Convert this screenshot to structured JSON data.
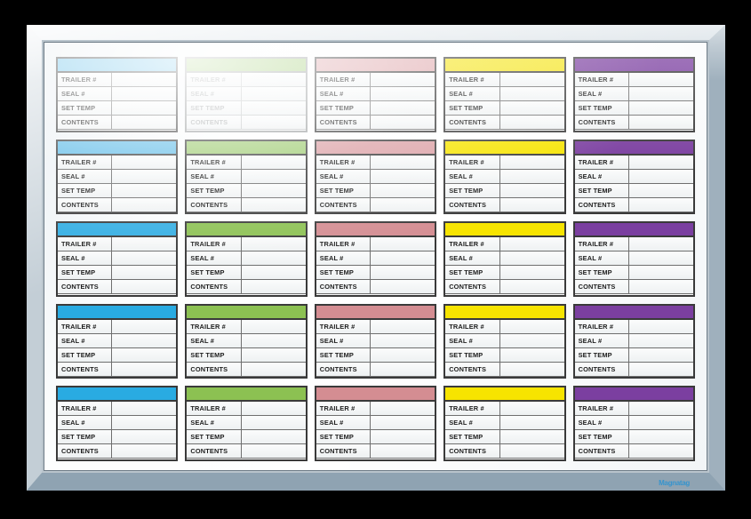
{
  "board": {
    "type": "dry-erase-whiteboard",
    "brand_mark": "Magnatag",
    "frame_color": "#b9c4cc",
    "surface_color": "#ffffff"
  },
  "card_fields": [
    "TRAILER #",
    "SEAL #",
    "SET TEMP",
    "CONTENTS"
  ],
  "columns": [
    {
      "name": "blue",
      "color": "#29abe2"
    },
    {
      "name": "green",
      "color": "#8cc152"
    },
    {
      "name": "pink",
      "color": "#d48d92"
    },
    {
      "name": "yellow",
      "color": "#f7e400"
    },
    {
      "name": "purple",
      "color": "#7b3fa0"
    }
  ],
  "grid": {
    "rows": 5,
    "cols": 5,
    "total_cards": 25
  },
  "cards": [
    [
      {
        "column": "blue",
        "header_color": "#6fc3ea",
        "faded": false,
        "trailer_no": "",
        "seal_no": "",
        "set_temp": "",
        "contents": "",
        "notes": ""
      },
      {
        "column": "green",
        "header_color": "#a5cf7c",
        "faded": true,
        "trailer_no": "",
        "seal_no": "",
        "set_temp": "",
        "contents": "",
        "notes": ""
      },
      {
        "column": "pink",
        "header_color": "#dfa9ad",
        "faded": false,
        "trailer_no": "",
        "seal_no": "",
        "set_temp": "",
        "contents": "",
        "notes": ""
      },
      {
        "column": "yellow",
        "header_color": "#f5e41b",
        "faded": false,
        "trailer_no": "",
        "seal_no": "",
        "set_temp": "",
        "contents": "",
        "notes": ""
      },
      {
        "column": "purple",
        "header_color": "#7b3fa0",
        "faded": false,
        "trailer_no": "",
        "seal_no": "",
        "set_temp": "",
        "contents": "",
        "notes": ""
      }
    ],
    [
      {
        "column": "blue",
        "header_color": "#63bde8",
        "faded": false,
        "trailer_no": "",
        "seal_no": "",
        "set_temp": "",
        "contents": "",
        "notes": ""
      },
      {
        "column": "green",
        "header_color": "#9ecb72",
        "faded": false,
        "trailer_no": "",
        "seal_no": "",
        "set_temp": "",
        "contents": "",
        "notes": ""
      },
      {
        "column": "pink",
        "header_color": "#dba0a5",
        "faded": false,
        "trailer_no": "",
        "seal_no": "",
        "set_temp": "",
        "contents": "",
        "notes": ""
      },
      {
        "column": "yellow",
        "header_color": "#f7e400",
        "faded": false,
        "trailer_no": "",
        "seal_no": "",
        "set_temp": "",
        "contents": "",
        "notes": ""
      },
      {
        "column": "purple",
        "header_color": "#7b3fa0",
        "faded": false,
        "trailer_no": "",
        "seal_no": "",
        "set_temp": "",
        "contents": "",
        "notes": ""
      }
    ],
    [
      {
        "column": "blue",
        "header_color": "#33aee3",
        "faded": false,
        "trailer_no": "",
        "seal_no": "",
        "set_temp": "",
        "contents": "",
        "notes": ""
      },
      {
        "column": "green",
        "header_color": "#8cc152",
        "faded": false,
        "trailer_no": "",
        "seal_no": "",
        "set_temp": "",
        "contents": "",
        "notes": ""
      },
      {
        "column": "pink",
        "header_color": "#d48d92",
        "faded": false,
        "trailer_no": "",
        "seal_no": "",
        "set_temp": "",
        "contents": "",
        "notes": ""
      },
      {
        "column": "yellow",
        "header_color": "#f7e400",
        "faded": false,
        "trailer_no": "",
        "seal_no": "",
        "set_temp": "",
        "contents": "",
        "notes": ""
      },
      {
        "column": "purple",
        "header_color": "#7b3fa0",
        "faded": false,
        "trailer_no": "",
        "seal_no": "",
        "set_temp": "",
        "contents": "",
        "notes": ""
      }
    ],
    [
      {
        "column": "blue",
        "header_color": "#29abe2",
        "faded": false,
        "trailer_no": "",
        "seal_no": "",
        "set_temp": "",
        "contents": "",
        "notes": ""
      },
      {
        "column": "green",
        "header_color": "#8cc152",
        "faded": false,
        "trailer_no": "",
        "seal_no": "",
        "set_temp": "",
        "contents": "",
        "notes": ""
      },
      {
        "column": "pink",
        "header_color": "#d48d92",
        "faded": false,
        "trailer_no": "",
        "seal_no": "",
        "set_temp": "",
        "contents": "",
        "notes": ""
      },
      {
        "column": "yellow",
        "header_color": "#f7e400",
        "faded": false,
        "trailer_no": "",
        "seal_no": "",
        "set_temp": "",
        "contents": "",
        "notes": ""
      },
      {
        "column": "purple",
        "header_color": "#7b3fa0",
        "faded": false,
        "trailer_no": "",
        "seal_no": "",
        "set_temp": "",
        "contents": "",
        "notes": ""
      }
    ],
    [
      {
        "column": "blue",
        "header_color": "#29abe2",
        "faded": false,
        "trailer_no": "",
        "seal_no": "",
        "set_temp": "",
        "contents": "",
        "notes": ""
      },
      {
        "column": "green",
        "header_color": "#8cc152",
        "faded": false,
        "trailer_no": "",
        "seal_no": "",
        "set_temp": "",
        "contents": "",
        "notes": ""
      },
      {
        "column": "pink",
        "header_color": "#d48d92",
        "faded": false,
        "trailer_no": "",
        "seal_no": "",
        "set_temp": "",
        "contents": "",
        "notes": ""
      },
      {
        "column": "yellow",
        "header_color": "#f7e400",
        "faded": false,
        "trailer_no": "",
        "seal_no": "",
        "set_temp": "",
        "contents": "",
        "notes": ""
      },
      {
        "column": "purple",
        "header_color": "#7b3fa0",
        "faded": false,
        "trailer_no": "",
        "seal_no": "",
        "set_temp": "",
        "contents": "",
        "notes": ""
      }
    ]
  ]
}
